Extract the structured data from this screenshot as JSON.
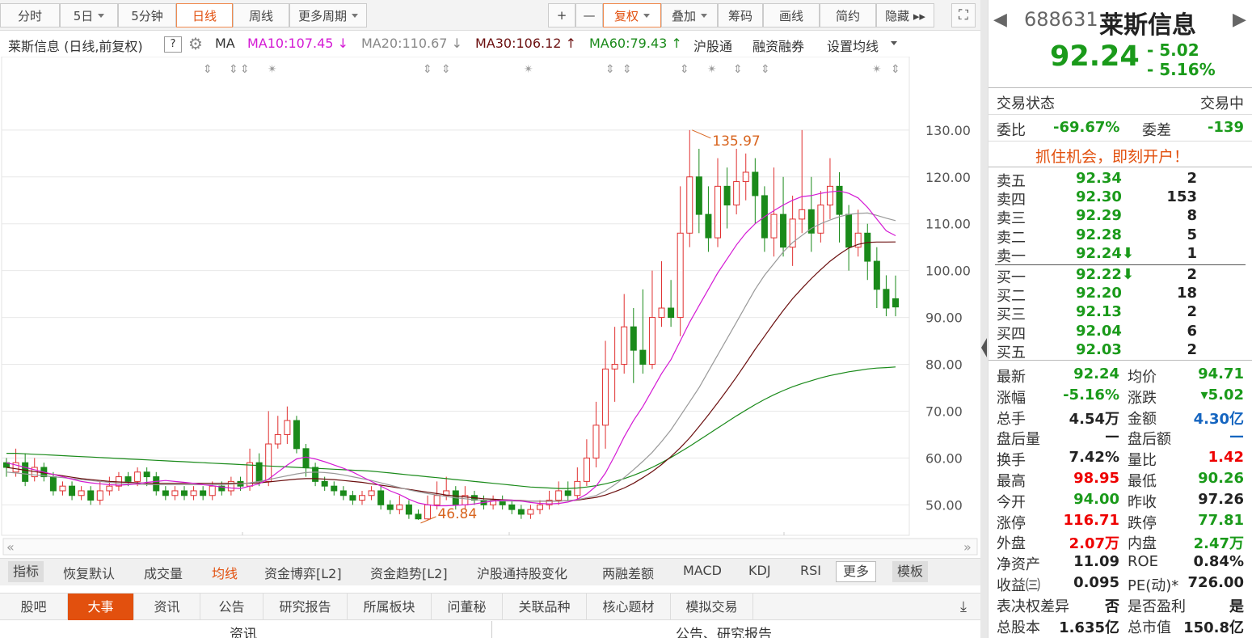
{
  "toolbar": {
    "items": [
      {
        "label": "分时",
        "active": false,
        "dropdown": false
      },
      {
        "label": "5日",
        "active": false,
        "dropdown": true
      },
      {
        "label": "5分钟",
        "active": false,
        "dropdown": false
      },
      {
        "label": "日线",
        "active": true,
        "dropdown": false
      },
      {
        "label": "周线",
        "active": false,
        "dropdown": false
      },
      {
        "label": "更多周期",
        "active": false,
        "dropdown": true
      }
    ],
    "right_items": [
      {
        "label": "+",
        "active": false,
        "dropdown": false
      },
      {
        "label": "—",
        "active": false,
        "dropdown": false
      },
      {
        "label": "复权",
        "active": true,
        "dropdown": true
      },
      {
        "label": "叠加",
        "active": false,
        "dropdown": true
      },
      {
        "label": "筹码",
        "active": false,
        "dropdown": false
      },
      {
        "label": "画线",
        "active": false,
        "dropdown": false
      },
      {
        "label": "简约",
        "active": false,
        "dropdown": false
      },
      {
        "label": "隐藏 ▸▸",
        "active": false,
        "dropdown": false
      }
    ],
    "expand_icon": "expand-icon"
  },
  "ma_row": {
    "title": "莱斯信息 (日线,前复权)",
    "help": "?",
    "ma_label": "MA",
    "ma10": "MA10:107.45 ↓",
    "ma20": "MA20:110.67 ↓",
    "ma30": "MA30:106.12 ↑",
    "ma60": "MA60:79.43 ↑",
    "links": [
      "沪股通",
      "融资融券",
      "设置均线"
    ],
    "colors": {
      "ma10": "#d41ad4",
      "ma20": "#888888",
      "ma30": "#6b0f0f",
      "ma60": "#1a8a1a"
    }
  },
  "indicators": {
    "items": [
      "指标",
      "恢复默认",
      "成交量",
      "均线",
      "资金博弈[L2]",
      "资金趋势[L2]",
      "沪股通持股变化",
      "两融差额",
      "MACD",
      "KDJ",
      "RSI",
      "更多",
      "模板"
    ],
    "active": "均线"
  },
  "tabs": {
    "items": [
      "股吧",
      "大事",
      "资讯",
      "公告",
      "研究报告",
      "所属板块",
      "问董秘",
      "关联品种",
      "核心题材",
      "模拟交易"
    ],
    "active": "大事"
  },
  "bottom": {
    "left": "资讯",
    "right": "公告、研究报告"
  },
  "quote": {
    "code": "688631",
    "name": "莱斯信息",
    "price": "92.24",
    "change": "- 5.02",
    "change_pct": "- 5.16%",
    "status_label": "交易状态",
    "status_value": "交易中",
    "wb_label": "委比",
    "wb_value": "-69.67%",
    "wc_label": "委差",
    "wc_value": "-139",
    "promo": "抓住机会，即刻开户！",
    "asks": [
      {
        "label": "卖五",
        "price": "92.34",
        "vol": "2"
      },
      {
        "label": "卖四",
        "price": "92.30",
        "vol": "153"
      },
      {
        "label": "卖三",
        "price": "92.29",
        "vol": "8"
      },
      {
        "label": "卖二",
        "price": "92.28",
        "vol": "5"
      },
      {
        "label": "卖一",
        "price": "92.24⬇",
        "vol": "1"
      }
    ],
    "bids": [
      {
        "label": "买一",
        "price": "92.22⬇",
        "vol": "2"
      },
      {
        "label": "买二",
        "price": "92.20",
        "vol": "18"
      },
      {
        "label": "买三",
        "price": "92.13",
        "vol": "2"
      },
      {
        "label": "买四",
        "price": "92.04",
        "vol": "6"
      },
      {
        "label": "买五",
        "price": "92.03",
        "vol": "2"
      }
    ],
    "stats": [
      [
        {
          "label": "最新",
          "value": "92.24",
          "color": "green"
        },
        {
          "label": "均价",
          "value": "94.71",
          "color": "green"
        }
      ],
      [
        {
          "label": "涨幅",
          "value": "-5.16%",
          "color": "green"
        },
        {
          "label": "涨跌",
          "value": "▾5.02",
          "color": "green"
        }
      ],
      [
        {
          "label": "总手",
          "value": "4.54万",
          "color": "dark"
        },
        {
          "label": "金额",
          "value": "4.30亿",
          "color": "blue"
        }
      ],
      [
        {
          "label": "盘后量",
          "value": "—",
          "color": "dark"
        },
        {
          "label": "盘后额",
          "value": "—",
          "color": "blue"
        }
      ],
      [
        {
          "label": "换手",
          "value": "7.42%",
          "color": "dark"
        },
        {
          "label": "量比",
          "value": "1.42",
          "color": "red"
        }
      ],
      [
        {
          "label": "最高",
          "value": "98.95",
          "color": "red"
        },
        {
          "label": "最低",
          "value": "90.26",
          "color": "green"
        }
      ],
      [
        {
          "label": "今开",
          "value": "94.00",
          "color": "green"
        },
        {
          "label": "昨收",
          "value": "97.26",
          "color": "dark"
        }
      ],
      [
        {
          "label": "涨停",
          "value": "116.71",
          "color": "red"
        },
        {
          "label": "跌停",
          "value": "77.81",
          "color": "green"
        }
      ],
      [
        {
          "label": "外盘",
          "value": "2.07万",
          "color": "red"
        },
        {
          "label": "内盘",
          "value": "2.47万",
          "color": "green"
        }
      ],
      [
        {
          "label": "净资产",
          "value": "11.09",
          "color": "dark"
        },
        {
          "label": "ROE",
          "value": "0.84%",
          "color": "dark"
        }
      ],
      [
        {
          "label": "收益㈢",
          "value": "0.095",
          "color": "dark"
        },
        {
          "label": "PE(动)*",
          "value": "726.00",
          "color": "dark"
        }
      ],
      [
        {
          "label": "表决权差异",
          "value": "否",
          "color": "dark"
        },
        {
          "label": "是否盈利",
          "value": "是",
          "color": "dark"
        }
      ],
      [
        {
          "label": "总股本",
          "value": "1.635亿",
          "color": "dark"
        },
        {
          "label": "总市值",
          "value": "150.8亿",
          "color": "dark"
        }
      ]
    ]
  },
  "chart_data": {
    "type": "candlestick",
    "y_ticks": [
      "130.00",
      "120.00",
      "110.00",
      "100.00",
      "90.00",
      "80.00",
      "70.00",
      "60.00",
      "50.00"
    ],
    "ylim": [
      43.5,
      140.5
    ],
    "up_color": "#e03030",
    "down_color": "#1a8a1a",
    "high_annotation": "135.97",
    "low_annotation": "46.84",
    "candles": [
      [
        59,
        58,
        60,
        56
      ],
      [
        57,
        59,
        62,
        56
      ],
      [
        59,
        55,
        61,
        54
      ],
      [
        56,
        58,
        60,
        55
      ],
      [
        58,
        56,
        59,
        55
      ],
      [
        56,
        53,
        57,
        52
      ],
      [
        53,
        54,
        55,
        52
      ],
      [
        54,
        52,
        55,
        51
      ],
      [
        52,
        53,
        54,
        51
      ],
      [
        53,
        51,
        54,
        50
      ],
      [
        51,
        53,
        55,
        50
      ],
      [
        53,
        54,
        56,
        52
      ],
      [
        54,
        56,
        57,
        53
      ],
      [
        56,
        55,
        57,
        54
      ],
      [
        55,
        57,
        58,
        54
      ],
      [
        57,
        56,
        58,
        54
      ],
      [
        56,
        53,
        57,
        52
      ],
      [
        53,
        52,
        54,
        51
      ],
      [
        52,
        53,
        54,
        51
      ],
      [
        53,
        52,
        54,
        51
      ],
      [
        52,
        53,
        54,
        51
      ],
      [
        53,
        52,
        54,
        51
      ],
      [
        52,
        54,
        55,
        51
      ],
      [
        54,
        53,
        55,
        52
      ],
      [
        53,
        55,
        56,
        52
      ],
      [
        55,
        54,
        56,
        53
      ],
      [
        54,
        59,
        62,
        53
      ],
      [
        59,
        55,
        61,
        54
      ],
      [
        55,
        63,
        70,
        54
      ],
      [
        63,
        65,
        69,
        62
      ],
      [
        65,
        68,
        71,
        63
      ],
      [
        68,
        62,
        69,
        61
      ],
      [
        62,
        58,
        63,
        56
      ],
      [
        58,
        55,
        59,
        54
      ],
      [
        55,
        54,
        56,
        53
      ],
      [
        54,
        53,
        55,
        52
      ],
      [
        53,
        52,
        54,
        51
      ],
      [
        52,
        51,
        53,
        50
      ],
      [
        51,
        52,
        53,
        50
      ],
      [
        52,
        53,
        54,
        51
      ],
      [
        53,
        50,
        54,
        49
      ],
      [
        50,
        49,
        51,
        48
      ],
      [
        49,
        50,
        52,
        48
      ],
      [
        50,
        48,
        51,
        47
      ],
      [
        48,
        47,
        49,
        46.8
      ],
      [
        47,
        50,
        52,
        46.84
      ],
      [
        50,
        52,
        55,
        49
      ],
      [
        52,
        53,
        56,
        51
      ],
      [
        53,
        50,
        54,
        49
      ],
      [
        50,
        52,
        54,
        49
      ],
      [
        52,
        51,
        53,
        50
      ],
      [
        51,
        50,
        52,
        49
      ],
      [
        50,
        51,
        52,
        49
      ],
      [
        51,
        50,
        52,
        49
      ],
      [
        50,
        49,
        51,
        48
      ],
      [
        49,
        48,
        50,
        47
      ],
      [
        48,
        49,
        50,
        47
      ],
      [
        49,
        50,
        51,
        48
      ],
      [
        50,
        51,
        53,
        49
      ],
      [
        51,
        53,
        55,
        50
      ],
      [
        53,
        52,
        55,
        51
      ],
      [
        52,
        55,
        58,
        51
      ],
      [
        55,
        60,
        64,
        54
      ],
      [
        60,
        67,
        72,
        58
      ],
      [
        67,
        79,
        85,
        62
      ],
      [
        79,
        80,
        88,
        72
      ],
      [
        80,
        88,
        95,
        78
      ],
      [
        88,
        83,
        92,
        76
      ],
      [
        83,
        80,
        96,
        78
      ],
      [
        80,
        90,
        100,
        79
      ],
      [
        90,
        92,
        102,
        88
      ],
      [
        92,
        90,
        98,
        88
      ],
      [
        90,
        108,
        118,
        86
      ],
      [
        108,
        120,
        130,
        105
      ],
      [
        120,
        112,
        126,
        108
      ],
      [
        112,
        107,
        118,
        104
      ],
      [
        107,
        118,
        124,
        105
      ],
      [
        118,
        114,
        122,
        109
      ],
      [
        114,
        119,
        126,
        112
      ],
      [
        119,
        121,
        125,
        115
      ],
      [
        121,
        116,
        124,
        110
      ],
      [
        116,
        107,
        118,
        104
      ],
      [
        107,
        112,
        122,
        103
      ],
      [
        112,
        105,
        120,
        103
      ],
      [
        105,
        111,
        116,
        101
      ],
      [
        111,
        113,
        130,
        108
      ],
      [
        113,
        108,
        120,
        104
      ],
      [
        108,
        114,
        117,
        106
      ],
      [
        114,
        118,
        124,
        111
      ],
      [
        118,
        112,
        121,
        106
      ],
      [
        112,
        105,
        114,
        100
      ],
      [
        105,
        108,
        113,
        103
      ],
      [
        108,
        102,
        110,
        98
      ],
      [
        102,
        96,
        105,
        92
      ],
      [
        96,
        92,
        99,
        90.26
      ],
      [
        94,
        92.24,
        98.95,
        90.26
      ]
    ],
    "ma10": [
      59,
      58.5,
      58,
      57.5,
      57,
      56.5,
      56,
      55.5,
      55,
      54.7,
      54.5,
      54.3,
      54.2,
      54.3,
      54.5,
      54.8,
      55,
      55.2,
      55,
      54.8,
      54.6,
      54.3,
      54.1,
      53.8,
      53.6,
      53.5,
      54,
      54.5,
      55.5,
      57,
      58.5,
      59.8,
      60.2,
      59.8,
      59.2,
      58.5,
      57.8,
      57,
      56,
      55,
      54,
      53,
      52.2,
      51.2,
      50.4,
      50,
      49.8,
      49.8,
      49.9,
      50,
      50.2,
      50.5,
      50.8,
      51,
      51,
      50.8,
      50.5,
      50.3,
      50.2,
      50.3,
      50.6,
      51.2,
      52.3,
      54,
      56.8,
      60.5,
      64.5,
      68,
      71,
      74.5,
      78,
      81,
      85,
      89,
      92.5,
      96,
      99.5,
      102.5,
      105.5,
      108,
      110,
      111.5,
      112.8,
      114,
      115,
      115.8,
      116,
      116.5,
      116.8,
      117,
      116.5,
      115.5,
      113.5,
      111,
      108.5,
      107.45
    ],
    "ma20": [
      57,
      56.8,
      56.6,
      56.4,
      56.2,
      56,
      55.8,
      55.6,
      55.4,
      55.2,
      55,
      54.8,
      54.6,
      54.5,
      54.4,
      54.3,
      54.3,
      54.3,
      54.3,
      54.3,
      54.3,
      54.3,
      54.3,
      54.3,
      54.4,
      54.5,
      54.7,
      55,
      55.4,
      55.8,
      56.2,
      56.6,
      56.9,
      57,
      56.9,
      56.7,
      56.4,
      56,
      55.6,
      55.2,
      54.7,
      54.2,
      53.7,
      53.2,
      52.8,
      52.4,
      52.1,
      51.8,
      51.5,
      51.3,
      51.1,
      51,
      50.9,
      50.8,
      50.8,
      50.8,
      50.8,
      50.8,
      50.8,
      50.8,
      50.9,
      51.1,
      51.5,
      52,
      53,
      54.3,
      55.8,
      57.5,
      59.3,
      61.2,
      63.5,
      66,
      69,
      72,
      75,
      78.5,
      82,
      85.5,
      89,
      92.5,
      96,
      99,
      101.5,
      104,
      106,
      107.5,
      109,
      110,
      110.8,
      111.5,
      112,
      112.2,
      112.3,
      111.8,
      111.2,
      110.67
    ],
    "ma30": [
      58,
      57.7,
      57.4,
      57.1,
      56.8,
      56.5,
      56.2,
      55.9,
      55.6,
      55.4,
      55.2,
      55,
      54.9,
      54.8,
      54.7,
      54.6,
      54.6,
      54.6,
      54.6,
      54.6,
      54.6,
      54.6,
      54.6,
      54.6,
      54.6,
      54.6,
      54.6,
      54.7,
      54.9,
      55.1,
      55.3,
      55.5,
      55.6,
      55.6,
      55.5,
      55.4,
      55.2,
      55,
      54.8,
      54.5,
      54.2,
      53.9,
      53.6,
      53.3,
      53,
      52.7,
      52.4,
      52.1,
      51.9,
      51.7,
      51.5,
      51.3,
      51.2,
      51.1,
      51,
      50.9,
      50.8,
      50.8,
      50.8,
      50.8,
      50.9,
      51,
      51.3,
      51.6,
      52.1,
      52.8,
      53.6,
      54.6,
      55.8,
      57.1,
      58.6,
      60.3,
      62.2,
      64.3,
      66.7,
      69.2,
      71.8,
      74.5,
      77.3,
      80.2,
      83.2,
      86,
      88.8,
      91.5,
      94,
      96.2,
      98.3,
      100.2,
      102,
      103.5,
      104.8,
      105.6,
      106,
      106.1,
      106.1,
      106.12
    ],
    "ma60": [
      61,
      61,
      60.9,
      60.8,
      60.7,
      60.6,
      60.5,
      60.4,
      60.3,
      60.2,
      60.1,
      60,
      59.9,
      59.8,
      59.7,
      59.6,
      59.5,
      59.4,
      59.3,
      59.2,
      59.1,
      59,
      58.9,
      58.8,
      58.7,
      58.6,
      58.5,
      58.4,
      58.3,
      58.2,
      58.1,
      58,
      57.9,
      57.8,
      57.7,
      57.6,
      57.5,
      57.4,
      57.3,
      57.2,
      57,
      56.8,
      56.6,
      56.4,
      56.2,
      56,
      55.8,
      55.6,
      55.4,
      55.2,
      55,
      54.8,
      54.6,
      54.4,
      54.2,
      54,
      53.8,
      53.7,
      53.6,
      53.5,
      53.5,
      53.6,
      53.8,
      54.1,
      54.5,
      55,
      55.6,
      56.3,
      57.1,
      58,
      59,
      60.1,
      61.3,
      62.5,
      63.8,
      65.1,
      66.4,
      67.7,
      69,
      70.2,
      71.4,
      72.5,
      73.5,
      74.4,
      75.2,
      75.9,
      76.5,
      77.1,
      77.6,
      78,
      78.4,
      78.7,
      79,
      79.2,
      79.3,
      79.43
    ],
    "event_markers": [
      "⇕",
      "⇕",
      "⇕",
      "✴",
      "⇕",
      "⇕",
      "✴",
      "⇕",
      "⇕",
      "⇕",
      "✴",
      "⇕",
      "⇕",
      "✴",
      "⇕",
      "✴",
      "✴"
    ]
  }
}
